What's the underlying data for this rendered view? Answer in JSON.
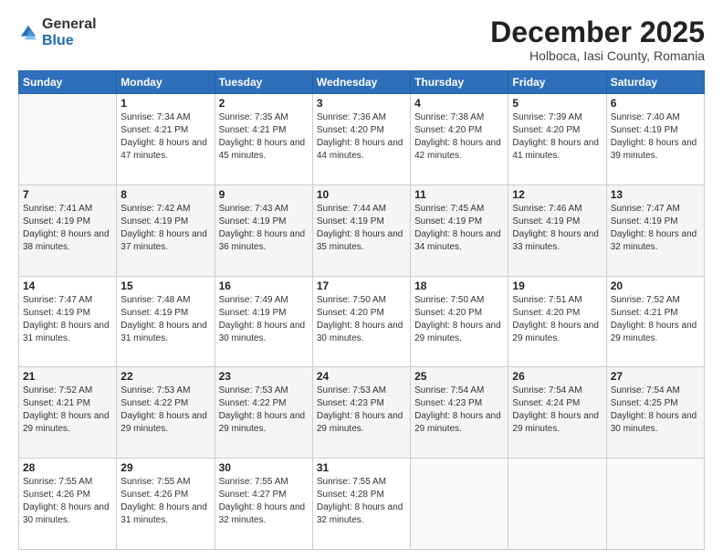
{
  "header": {
    "logo": {
      "general": "General",
      "blue": "Blue"
    },
    "title": "December 2025",
    "subtitle": "Holboca, Iasi County, Romania"
  },
  "weekdays": [
    "Sunday",
    "Monday",
    "Tuesday",
    "Wednesday",
    "Thursday",
    "Friday",
    "Saturday"
  ],
  "weeks": [
    [
      {
        "day": "",
        "sunrise": "",
        "sunset": "",
        "daylight": ""
      },
      {
        "day": "1",
        "sunrise": "Sunrise: 7:34 AM",
        "sunset": "Sunset: 4:21 PM",
        "daylight": "Daylight: 8 hours and 47 minutes."
      },
      {
        "day": "2",
        "sunrise": "Sunrise: 7:35 AM",
        "sunset": "Sunset: 4:21 PM",
        "daylight": "Daylight: 8 hours and 45 minutes."
      },
      {
        "day": "3",
        "sunrise": "Sunrise: 7:36 AM",
        "sunset": "Sunset: 4:20 PM",
        "daylight": "Daylight: 8 hours and 44 minutes."
      },
      {
        "day": "4",
        "sunrise": "Sunrise: 7:38 AM",
        "sunset": "Sunset: 4:20 PM",
        "daylight": "Daylight: 8 hours and 42 minutes."
      },
      {
        "day": "5",
        "sunrise": "Sunrise: 7:39 AM",
        "sunset": "Sunset: 4:20 PM",
        "daylight": "Daylight: 8 hours and 41 minutes."
      },
      {
        "day": "6",
        "sunrise": "Sunrise: 7:40 AM",
        "sunset": "Sunset: 4:19 PM",
        "daylight": "Daylight: 8 hours and 39 minutes."
      }
    ],
    [
      {
        "day": "7",
        "sunrise": "Sunrise: 7:41 AM",
        "sunset": "Sunset: 4:19 PM",
        "daylight": "Daylight: 8 hours and 38 minutes."
      },
      {
        "day": "8",
        "sunrise": "Sunrise: 7:42 AM",
        "sunset": "Sunset: 4:19 PM",
        "daylight": "Daylight: 8 hours and 37 minutes."
      },
      {
        "day": "9",
        "sunrise": "Sunrise: 7:43 AM",
        "sunset": "Sunset: 4:19 PM",
        "daylight": "Daylight: 8 hours and 36 minutes."
      },
      {
        "day": "10",
        "sunrise": "Sunrise: 7:44 AM",
        "sunset": "Sunset: 4:19 PM",
        "daylight": "Daylight: 8 hours and 35 minutes."
      },
      {
        "day": "11",
        "sunrise": "Sunrise: 7:45 AM",
        "sunset": "Sunset: 4:19 PM",
        "daylight": "Daylight: 8 hours and 34 minutes."
      },
      {
        "day": "12",
        "sunrise": "Sunrise: 7:46 AM",
        "sunset": "Sunset: 4:19 PM",
        "daylight": "Daylight: 8 hours and 33 minutes."
      },
      {
        "day": "13",
        "sunrise": "Sunrise: 7:47 AM",
        "sunset": "Sunset: 4:19 PM",
        "daylight": "Daylight: 8 hours and 32 minutes."
      }
    ],
    [
      {
        "day": "14",
        "sunrise": "Sunrise: 7:47 AM",
        "sunset": "Sunset: 4:19 PM",
        "daylight": "Daylight: 8 hours and 31 minutes."
      },
      {
        "day": "15",
        "sunrise": "Sunrise: 7:48 AM",
        "sunset": "Sunset: 4:19 PM",
        "daylight": "Daylight: 8 hours and 31 minutes."
      },
      {
        "day": "16",
        "sunrise": "Sunrise: 7:49 AM",
        "sunset": "Sunset: 4:19 PM",
        "daylight": "Daylight: 8 hours and 30 minutes."
      },
      {
        "day": "17",
        "sunrise": "Sunrise: 7:50 AM",
        "sunset": "Sunset: 4:20 PM",
        "daylight": "Daylight: 8 hours and 30 minutes."
      },
      {
        "day": "18",
        "sunrise": "Sunrise: 7:50 AM",
        "sunset": "Sunset: 4:20 PM",
        "daylight": "Daylight: 8 hours and 29 minutes."
      },
      {
        "day": "19",
        "sunrise": "Sunrise: 7:51 AM",
        "sunset": "Sunset: 4:20 PM",
        "daylight": "Daylight: 8 hours and 29 minutes."
      },
      {
        "day": "20",
        "sunrise": "Sunrise: 7:52 AM",
        "sunset": "Sunset: 4:21 PM",
        "daylight": "Daylight: 8 hours and 29 minutes."
      }
    ],
    [
      {
        "day": "21",
        "sunrise": "Sunrise: 7:52 AM",
        "sunset": "Sunset: 4:21 PM",
        "daylight": "Daylight: 8 hours and 29 minutes."
      },
      {
        "day": "22",
        "sunrise": "Sunrise: 7:53 AM",
        "sunset": "Sunset: 4:22 PM",
        "daylight": "Daylight: 8 hours and 29 minutes."
      },
      {
        "day": "23",
        "sunrise": "Sunrise: 7:53 AM",
        "sunset": "Sunset: 4:22 PM",
        "daylight": "Daylight: 8 hours and 29 minutes."
      },
      {
        "day": "24",
        "sunrise": "Sunrise: 7:53 AM",
        "sunset": "Sunset: 4:23 PM",
        "daylight": "Daylight: 8 hours and 29 minutes."
      },
      {
        "day": "25",
        "sunrise": "Sunrise: 7:54 AM",
        "sunset": "Sunset: 4:23 PM",
        "daylight": "Daylight: 8 hours and 29 minutes."
      },
      {
        "day": "26",
        "sunrise": "Sunrise: 7:54 AM",
        "sunset": "Sunset: 4:24 PM",
        "daylight": "Daylight: 8 hours and 29 minutes."
      },
      {
        "day": "27",
        "sunrise": "Sunrise: 7:54 AM",
        "sunset": "Sunset: 4:25 PM",
        "daylight": "Daylight: 8 hours and 30 minutes."
      }
    ],
    [
      {
        "day": "28",
        "sunrise": "Sunrise: 7:55 AM",
        "sunset": "Sunset: 4:26 PM",
        "daylight": "Daylight: 8 hours and 30 minutes."
      },
      {
        "day": "29",
        "sunrise": "Sunrise: 7:55 AM",
        "sunset": "Sunset: 4:26 PM",
        "daylight": "Daylight: 8 hours and 31 minutes."
      },
      {
        "day": "30",
        "sunrise": "Sunrise: 7:55 AM",
        "sunset": "Sunset: 4:27 PM",
        "daylight": "Daylight: 8 hours and 32 minutes."
      },
      {
        "day": "31",
        "sunrise": "Sunrise: 7:55 AM",
        "sunset": "Sunset: 4:28 PM",
        "daylight": "Daylight: 8 hours and 32 minutes."
      },
      {
        "day": "",
        "sunrise": "",
        "sunset": "",
        "daylight": ""
      },
      {
        "day": "",
        "sunrise": "",
        "sunset": "",
        "daylight": ""
      },
      {
        "day": "",
        "sunrise": "",
        "sunset": "",
        "daylight": ""
      }
    ]
  ]
}
